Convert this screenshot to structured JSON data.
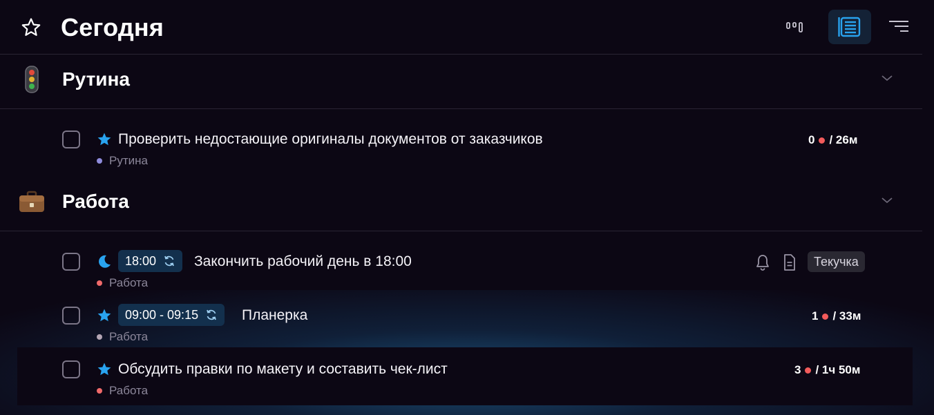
{
  "header": {
    "title": "Сегодня",
    "icon": "star-outline-icon",
    "view_buttons": [
      {
        "icon": "board-view-icon",
        "active": false
      },
      {
        "icon": "list-view-icon",
        "active": true
      },
      {
        "icon": "sort-filter-icon",
        "active": false
      }
    ]
  },
  "sections": [
    {
      "title": "Рутина",
      "icon": "traffic-light-icon",
      "tasks": [
        {
          "title": "Проверить недостающие оригиналы документов от заказчиков",
          "icon": "star-icon",
          "project": "Рутина",
          "project_color": "#8f8cdc",
          "meta_count": "0",
          "meta_duration": "/ 26м"
        }
      ]
    },
    {
      "title": "Работа",
      "icon": "briefcase-icon",
      "tasks": [
        {
          "title": "Закончить рабочий день в 18:00",
          "icon": "moon-icon",
          "time": "18:00",
          "project": "Работа",
          "project_color": "#f06a6a",
          "tag": "Текучка",
          "extra_icons": [
            "bell-icon",
            "note-icon"
          ]
        },
        {
          "title": "Планерка",
          "icon": "star-icon",
          "time": "09:00 - 09:15",
          "project": "Работа",
          "project_color": "#b4a6b4",
          "meta_count": "1",
          "meta_duration": "/ 33м"
        },
        {
          "title": "Обсудить правки по макету и составить чек-лист",
          "icon": "star-icon",
          "project": "Работа",
          "project_color": "#f06a6a",
          "meta_count": "3",
          "meta_duration": "/ 1ч 50м",
          "selected": true
        }
      ]
    }
  ],
  "colors": {
    "background": "#0c0714",
    "accent": "#29a3ef",
    "time_chip": "#13304d",
    "pomodoro_dot": "#f25b5b"
  }
}
